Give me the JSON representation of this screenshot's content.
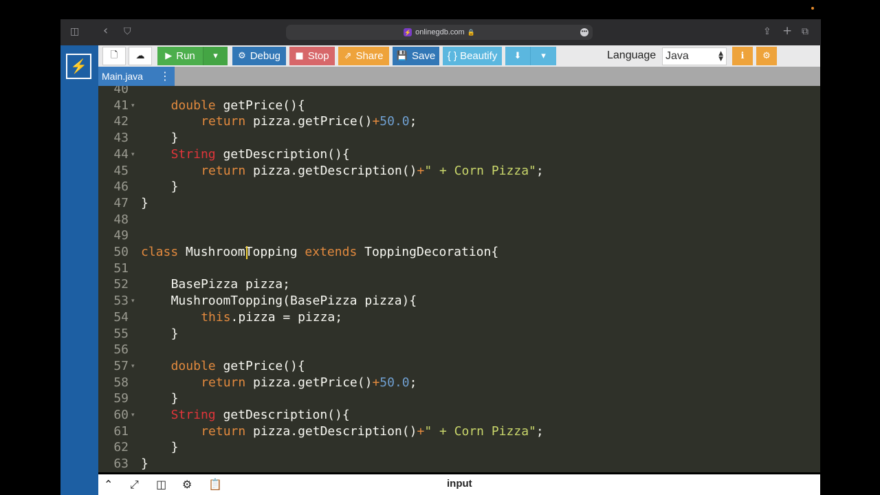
{
  "browser": {
    "url": "onlinegdb.com",
    "sidebar_icon": "◫",
    "back_icon": "‹",
    "shield_icon": "⛉",
    "share_icon": "⇪",
    "new_tab_icon": "+",
    "tabs_icon": "⧉"
  },
  "toolbar": {
    "run_label": "Run",
    "debug_label": "Debug",
    "stop_label": "Stop",
    "share_label": "Share",
    "save_label": "Save",
    "beautify_label": "{ } Beautify",
    "language_label": "Language",
    "language_value": "Java"
  },
  "tab": {
    "label": "Main.java"
  },
  "editor": {
    "lines": [
      {
        "n": "40",
        "code": ""
      },
      {
        "n": "41",
        "code": "double getPrice(){"
      },
      {
        "n": "42",
        "code": "return pizza.getPrice()+50.0;"
      },
      {
        "n": "43",
        "code": "}"
      },
      {
        "n": "44",
        "code": "String getDescription(){"
      },
      {
        "n": "45",
        "code": "return pizza.getDescription()+\" + Corn Pizza\";"
      },
      {
        "n": "46",
        "code": "}"
      },
      {
        "n": "47",
        "code": "}"
      },
      {
        "n": "48",
        "code": ""
      },
      {
        "n": "49",
        "code": ""
      },
      {
        "n": "50",
        "code": "class MushroomTopping extends ToppingDecoration{"
      },
      {
        "n": "51",
        "code": ""
      },
      {
        "n": "52",
        "code": "BasePizza pizza;"
      },
      {
        "n": "53",
        "code": "MushroomTopping(BasePizza pizza){"
      },
      {
        "n": "54",
        "code": "this.pizza = pizza;"
      },
      {
        "n": "55",
        "code": "}"
      },
      {
        "n": "56",
        "code": ""
      },
      {
        "n": "57",
        "code": "double getPrice(){"
      },
      {
        "n": "58",
        "code": "return pizza.getPrice()+50.0;"
      },
      {
        "n": "59",
        "code": "}"
      },
      {
        "n": "60",
        "code": "String getDescription(){"
      },
      {
        "n": "61",
        "code": "return pizza.getDescription()+\" + Corn Pizza\";"
      },
      {
        "n": "62",
        "code": "}"
      },
      {
        "n": "63",
        "code": "}"
      }
    ]
  },
  "bottom": {
    "input_label": "input"
  },
  "colors": {
    "rail": "#1d5fa3",
    "run": "#4cae4c",
    "debug": "#3277b6",
    "stop": "#d7676a",
    "share": "#eea33b",
    "beautify": "#5bb7df",
    "editor_bg": "#2f3129"
  }
}
